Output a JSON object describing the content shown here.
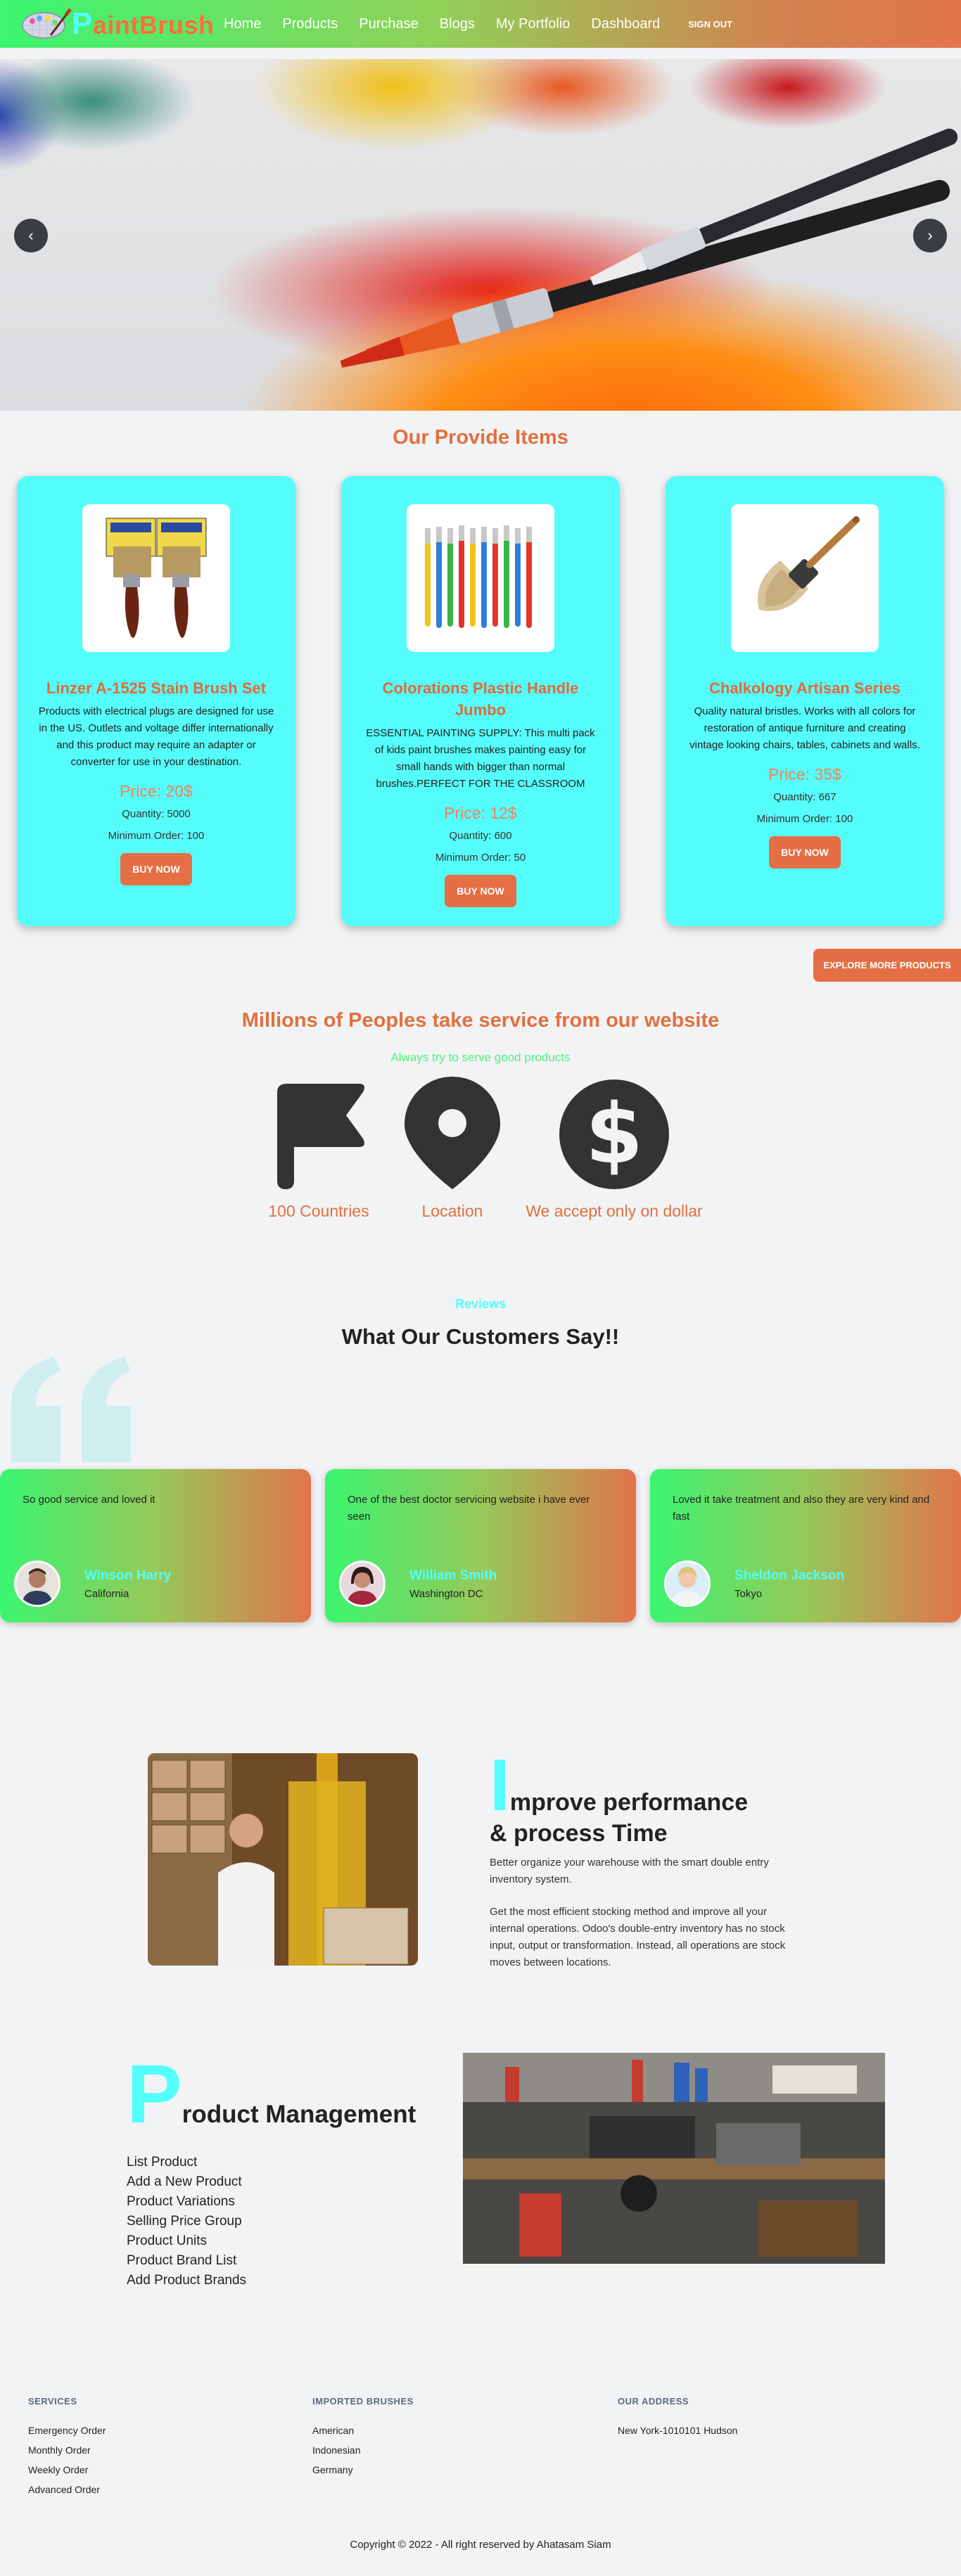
{
  "nav": {
    "logo_first": "P",
    "logo_rest": "aintBrush",
    "links": [
      "Home",
      "Products",
      "Purchase",
      "Blogs",
      "My Portfolio",
      "Dashboard"
    ],
    "signout": "SIGN OUT"
  },
  "hero": {
    "prev": "‹",
    "next": "›"
  },
  "provide": {
    "title": "Our Provide Items"
  },
  "products": [
    {
      "name": "Linzer A-1525 Stain Brush Set",
      "description": "Products with electrical plugs are designed for use in the US. Outlets and voltage differ internationally and this product may require an adapter or converter for use in your destination.",
      "price": "Price: 20$",
      "quantity": "Quantity: 5000",
      "min_order": "Minimum Order: 100",
      "button": "BUY NOW"
    },
    {
      "name": "Colorations Plastic Handle Jumbo",
      "description": "ESSENTIAL PAINTING SUPPLY: This multi pack of kids paint brushes makes painting easy for small hands with bigger than normal brushes.PERFECT FOR THE CLASSROOM",
      "price": "Price: 12$",
      "quantity": "Quantity: 600",
      "min_order": "Minimum Order: 50",
      "button": "BUY NOW"
    },
    {
      "name": "Chalkology Artisan Series",
      "description": "Quality natural bristles. Works with all colors for restoration of antique furniture and creating vintage looking chairs, tables, cabinets and walls.",
      "price": "Price: 35$",
      "quantity": "Quantity: 667",
      "min_order": "Minimum Order: 100",
      "button": "BUY NOW"
    }
  ],
  "explore_button": "EXPLORE MORE PRODUCTS",
  "stats": {
    "title": "Millions of Peoples take service from our website",
    "subtitle": "Always try to serve good products",
    "items": [
      {
        "label": "100 Countries",
        "icon": "flag-icon"
      },
      {
        "label": "Location",
        "icon": "location-pin-icon"
      },
      {
        "label": "We accept only on dollar",
        "icon": "dollar-icon"
      }
    ]
  },
  "reviews": {
    "label": "Reviews",
    "title": "What Our Customers Say!!",
    "items": [
      {
        "text": "So good service and loved it",
        "name": "Winson Harry",
        "place": "California"
      },
      {
        "text": "One of the best doctor servicing website i have ever seen",
        "name": "William Smith",
        "place": "Washington DC"
      },
      {
        "text": "Loved it take treatment and also they are very kind and fast",
        "name": "Sheldon Jackson",
        "place": "Tokyo"
      }
    ]
  },
  "improve": {
    "letter": "I",
    "title_rest": "mprove performance",
    "title_line2": "& process Time",
    "p1": "Better organize your warehouse with the smart double entry inventory system.",
    "p2": "Get the most efficient stocking method and improve all your internal operations. Odoo's double-entry inventory has no stock input, output or transformation. Instead, all operations are stock moves between locations."
  },
  "product_management": {
    "letter": "P",
    "title_rest": "roduct Management",
    "items": [
      "List Product",
      "Add a New Product",
      "Product Variations",
      "Selling Price Group",
      "Product Units",
      "Product Brand List",
      "Add Product Brands"
    ]
  },
  "footer": {
    "services": {
      "heading": "SERVICES",
      "items": [
        "Emergency Order",
        "Monthly Order",
        "Weekly Order",
        "Advanced Order"
      ]
    },
    "imported": {
      "heading": "IMPORTED BRUSHES",
      "items": [
        "American",
        "Indonesian",
        "Germany"
      ]
    },
    "address": {
      "heading": "OUR ADDRESS",
      "items": [
        "New York-1010101 Hudson"
      ]
    },
    "copyright": "Copyright © 2022 - All right reserved by Ahatasam Siam"
  }
}
